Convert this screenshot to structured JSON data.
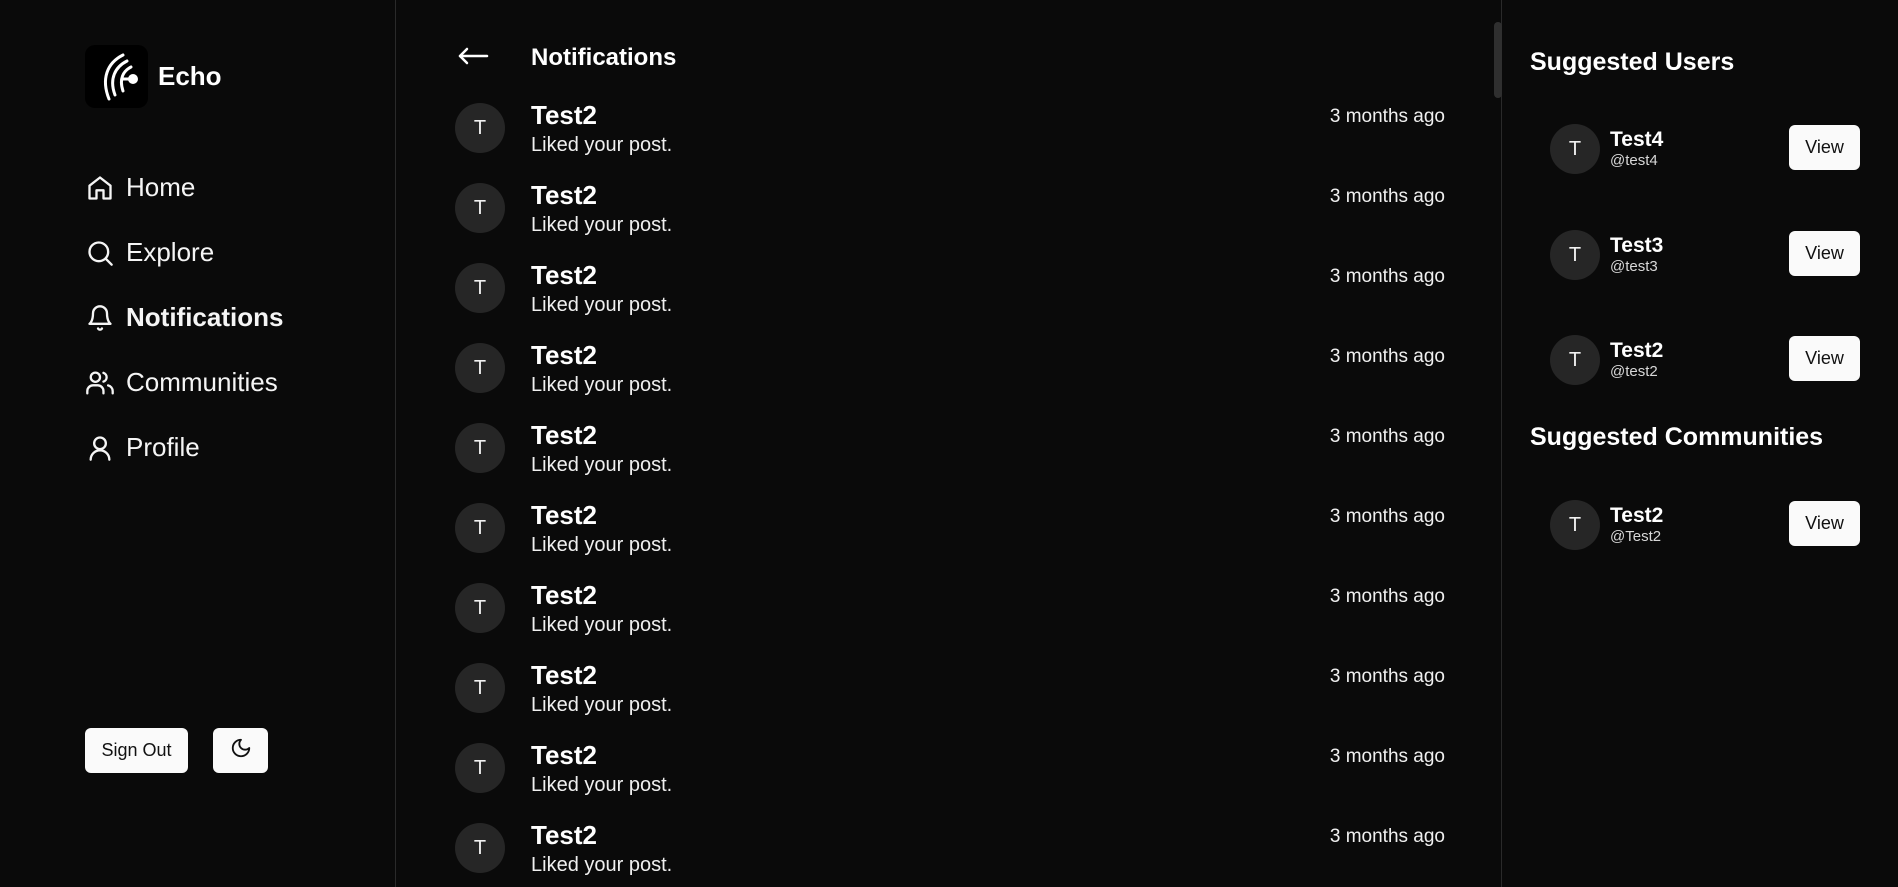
{
  "brand": {
    "name": "Echo"
  },
  "nav": [
    {
      "label": "Home",
      "icon": "home-icon",
      "active": false
    },
    {
      "label": "Explore",
      "icon": "search-icon",
      "active": false
    },
    {
      "label": "Notifications",
      "icon": "bell-icon",
      "active": true
    },
    {
      "label": "Communities",
      "icon": "users-icon",
      "active": false
    },
    {
      "label": "Profile",
      "icon": "user-icon",
      "active": false
    }
  ],
  "footer": {
    "signout_label": "Sign Out",
    "theme_icon": "moon-icon"
  },
  "main": {
    "back_icon": "arrow-left-icon",
    "title": "Notifications",
    "notifications": [
      {
        "avatar": "T",
        "name": "Test2",
        "text": "Liked your post.",
        "time": "3 months ago"
      },
      {
        "avatar": "T",
        "name": "Test2",
        "text": "Liked your post.",
        "time": "3 months ago"
      },
      {
        "avatar": "T",
        "name": "Test2",
        "text": "Liked your post.",
        "time": "3 months ago"
      },
      {
        "avatar": "T",
        "name": "Test2",
        "text": "Liked your post.",
        "time": "3 months ago"
      },
      {
        "avatar": "T",
        "name": "Test2",
        "text": "Liked your post.",
        "time": "3 months ago"
      },
      {
        "avatar": "T",
        "name": "Test2",
        "text": "Liked your post.",
        "time": "3 months ago"
      },
      {
        "avatar": "T",
        "name": "Test2",
        "text": "Liked your post.",
        "time": "3 months ago"
      },
      {
        "avatar": "T",
        "name": "Test2",
        "text": "Liked your post.",
        "time": "3 months ago"
      },
      {
        "avatar": "T",
        "name": "Test2",
        "text": "Liked your post.",
        "time": "3 months ago"
      },
      {
        "avatar": "T",
        "name": "Test2",
        "text": "Liked your post.",
        "time": "3 months ago"
      }
    ]
  },
  "right": {
    "users_title": "Suggested Users",
    "users": [
      {
        "avatar": "T",
        "name": "Test4",
        "handle": "@test4",
        "button": "View"
      },
      {
        "avatar": "T",
        "name": "Test3",
        "handle": "@test3",
        "button": "View"
      },
      {
        "avatar": "T",
        "name": "Test2",
        "handle": "@test2",
        "button": "View"
      }
    ],
    "communities_title": "Suggested Communities",
    "communities": [
      {
        "avatar": "T",
        "name": "Test2",
        "handle": "@Test2",
        "button": "View"
      }
    ]
  }
}
